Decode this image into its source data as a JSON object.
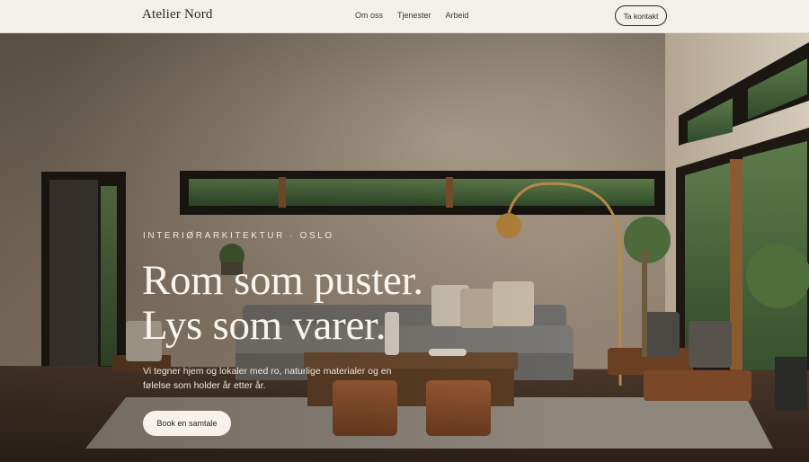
{
  "header": {
    "brand": "Atelier Nord",
    "nav": [
      {
        "label": "Om oss"
      },
      {
        "label": "Tjenester"
      },
      {
        "label": "Arbeid"
      }
    ],
    "contact_button": "Ta kontakt"
  },
  "hero": {
    "eyebrow": "INTERIØRARKITEKTUR · OSLO",
    "headline_line1": "Rom som puster.",
    "headline_line2": "Lys som varer.",
    "lede": "Vi tegner hjem og lokaler med ro, naturlige materialer og en følelse som holder år etter år.",
    "cta": "Book en samtale"
  },
  "colors": {
    "header_bg": "#f3f0ea",
    "wall": "#7d6f60",
    "floor": "#3e2e22",
    "text_light": "#f8f4ee"
  }
}
